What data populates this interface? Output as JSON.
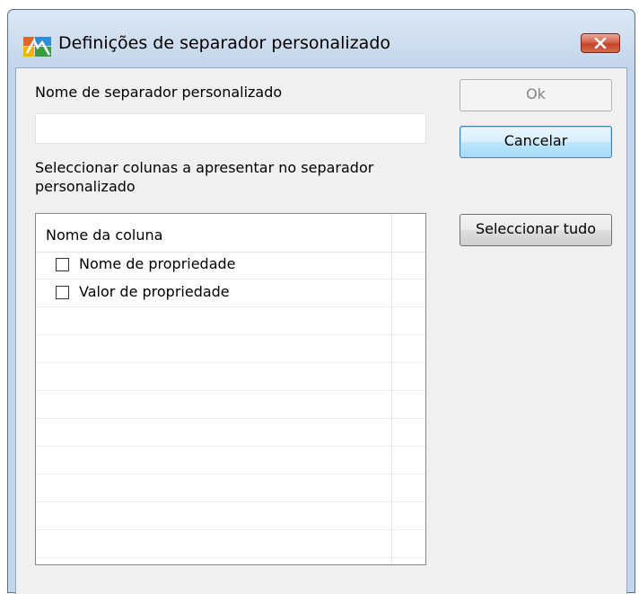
{
  "window": {
    "title": "Definições de separador personalizado",
    "icon": "avg-logo-icon",
    "close_icon": "close-icon"
  },
  "form": {
    "name_label": "Nome de separador personalizado",
    "name_value": "",
    "columns_label_line1": "Seleccionar colunas a apresentar no separador",
    "columns_label_line2": "personalizado"
  },
  "buttons": {
    "ok": "Ok",
    "cancel": "Cancelar",
    "select_all": "Seleccionar tudo"
  },
  "listview": {
    "column_header": "Nome da coluna",
    "rows": [
      {
        "label": "Nome de propriedade",
        "checked": false
      },
      {
        "label": "Valor de propriedade",
        "checked": false
      }
    ]
  },
  "colors": {
    "titlebar": "#c4d6eb",
    "client": "#f0f0f0",
    "close_button": "#c1442b",
    "default_button_border": "#3c7fb1"
  }
}
